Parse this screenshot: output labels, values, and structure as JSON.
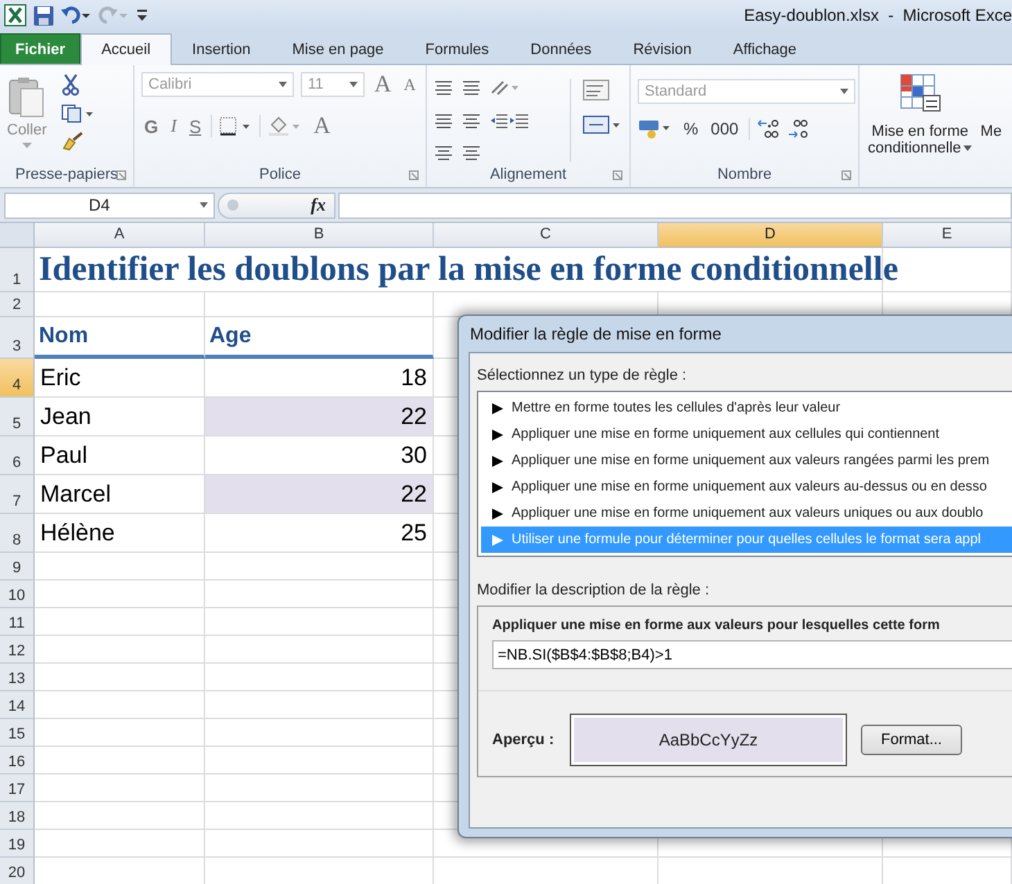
{
  "title_bar": {
    "title": "Easy-doublon.xlsx  -  Microsoft Exce"
  },
  "tabs": [
    {
      "label": "Fichier",
      "kind": "file",
      "selected": false
    },
    {
      "label": "Accueil",
      "kind": "tab",
      "selected": true
    },
    {
      "label": "Insertion",
      "kind": "tab",
      "selected": false
    },
    {
      "label": "Mise en page",
      "kind": "tab",
      "selected": false
    },
    {
      "label": "Formules",
      "kind": "tab",
      "selected": false
    },
    {
      "label": "Données",
      "kind": "tab",
      "selected": false
    },
    {
      "label": "Révision",
      "kind": "tab",
      "selected": false
    },
    {
      "label": "Affichage",
      "kind": "tab",
      "selected": false
    }
  ],
  "ribbon": {
    "clipboard": {
      "paste": "Coller",
      "group": "Presse-papiers"
    },
    "font": {
      "family": "Calibri",
      "size": "11",
      "grow": "A",
      "shrink": "A",
      "styles": [
        {
          "label": "G",
          "kind": "bold"
        },
        {
          "label": "I",
          "kind": "italic"
        },
        {
          "label": "S",
          "kind": "underline"
        }
      ],
      "font_color_label": "A",
      "group": "Police"
    },
    "alignment": {
      "group": "Alignement"
    },
    "number": {
      "format": "Standard",
      "percent": "%",
      "thousands": "000",
      "group": "Nombre"
    },
    "styles": {
      "conditional": [
        "Mise en forme",
        "conditionnelle"
      ],
      "next": "Me"
    }
  },
  "formula_bar": {
    "name_box": "D4",
    "fx": "fx"
  },
  "sheet": {
    "columns": [
      {
        "label": "A",
        "selected": false
      },
      {
        "label": "B",
        "selected": false
      },
      {
        "label": "C",
        "selected": false
      },
      {
        "label": "D",
        "selected": true
      },
      {
        "label": "E",
        "selected": false
      }
    ],
    "rows": [
      {
        "number": "1",
        "kind": "title",
        "selected": false,
        "text": "Identifier les doublons par la mise en forme conditionnelle"
      },
      {
        "number": "2",
        "kind": "blank",
        "selected": false
      },
      {
        "number": "3",
        "kind": "header",
        "selected": false,
        "name": "Nom",
        "age": "Age"
      },
      {
        "number": "4",
        "kind": "data",
        "selected": true,
        "name": "Eric",
        "age": "18",
        "highlighted": false
      },
      {
        "number": "5",
        "kind": "data",
        "selected": false,
        "name": "Jean",
        "age": "22",
        "highlighted": true
      },
      {
        "number": "6",
        "kind": "data",
        "selected": false,
        "name": "Paul",
        "age": "30",
        "highlighted": false
      },
      {
        "number": "7",
        "kind": "data",
        "selected": false,
        "name": "Marcel",
        "age": "22",
        "highlighted": true
      },
      {
        "number": "8",
        "kind": "data",
        "selected": false,
        "name": "Hélène",
        "age": "25",
        "highlighted": false
      },
      {
        "number": "9",
        "kind": "blank",
        "selected": false
      },
      {
        "number": "10",
        "kind": "blank",
        "selected": false
      },
      {
        "number": "11",
        "kind": "blank",
        "selected": false
      },
      {
        "number": "12",
        "kind": "blank",
        "selected": false
      },
      {
        "number": "13",
        "kind": "blank",
        "selected": false
      },
      {
        "number": "14",
        "kind": "blank",
        "selected": false
      },
      {
        "number": "15",
        "kind": "blank",
        "selected": false
      },
      {
        "number": "16",
        "kind": "blank",
        "selected": false
      },
      {
        "number": "17",
        "kind": "blank",
        "selected": false
      },
      {
        "number": "18",
        "kind": "blank",
        "selected": false
      },
      {
        "number": "19",
        "kind": "blank",
        "selected": false
      },
      {
        "number": "20",
        "kind": "blank",
        "selected": false
      }
    ]
  },
  "dialog": {
    "title": "Modifier la règle de mise en forme",
    "type_label": "Sélectionnez un type de règle :",
    "rule_types": [
      {
        "label": "Mettre en forme toutes les cellules d'après leur valeur",
        "selected": false
      },
      {
        "label": "Appliquer une mise en forme uniquement aux cellules qui contiennent",
        "selected": false
      },
      {
        "label": "Appliquer une mise en forme uniquement aux valeurs rangées parmi les prem",
        "selected": false
      },
      {
        "label": "Appliquer une mise en forme uniquement aux valeurs au-dessus ou en desso",
        "selected": false
      },
      {
        "label": "Appliquer une mise en forme uniquement aux valeurs uniques ou aux doublo",
        "selected": false
      },
      {
        "label": "Utiliser une formule pour déterminer pour quelles cellules le format sera appl",
        "selected": true
      }
    ],
    "description_label": "Modifier la description de la règle :",
    "formula_label": "Appliquer une mise en forme aux valeurs pour lesquelles cette form",
    "formula": "=NB.SI($B$4:$B$8;B4)>1",
    "preview_label": "Aperçu :",
    "preview_text": "AaBbCcYyZz",
    "format_button": "Format..."
  }
}
